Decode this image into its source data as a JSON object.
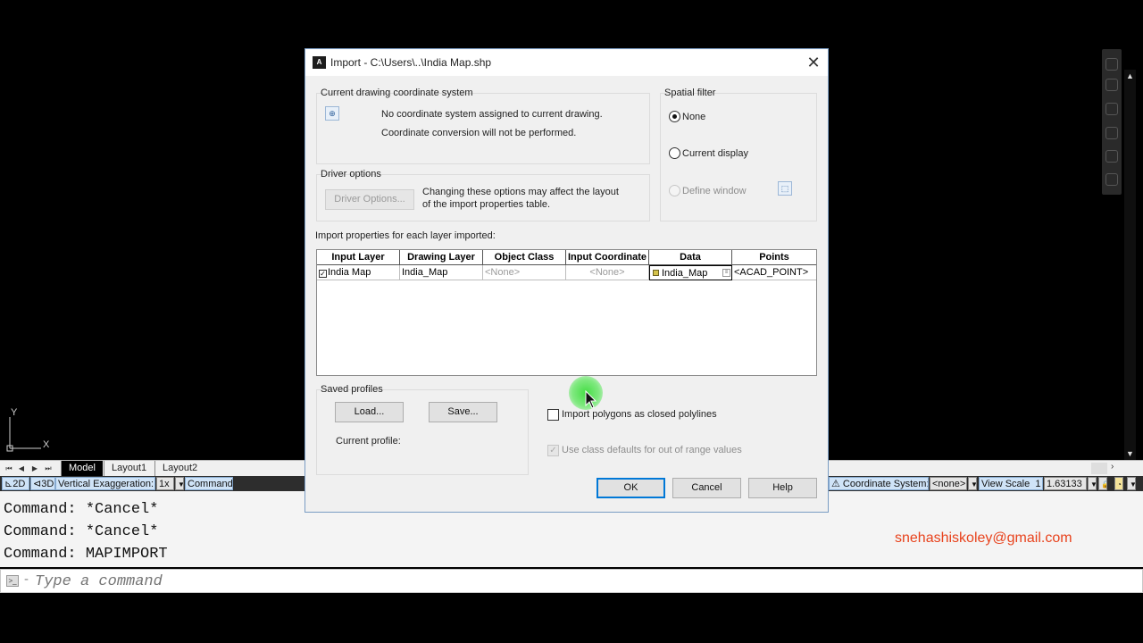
{
  "dialog": {
    "title": "Import - C:\\Users\\..\\India Map.shp",
    "coord_system": {
      "label": "Current drawing coordinate system",
      "line1": "No coordinate system assigned to current drawing.",
      "line2": "Coordinate conversion will not be performed."
    },
    "spatial_filter": {
      "label": "Spatial filter",
      "options": [
        "None",
        "Current display",
        "Define window"
      ],
      "selected": "None"
    },
    "driver_options": {
      "label": "Driver options",
      "button": "Driver Options...",
      "note_line1": "Changing these options may affect the layout",
      "note_line2": "of the import properties table."
    },
    "import_properties": {
      "label": "Import properties for each layer imported:",
      "columns": [
        "Input Layer",
        "Drawing Layer",
        "Object Class",
        "Input Coordinate",
        "Data",
        "Points"
      ],
      "rows": [
        {
          "checked": true,
          "input_layer": "India Map",
          "drawing_layer": "India_Map",
          "object_class": "<None>",
          "input_coordinate": "<None>",
          "data": "India_Map",
          "points": "<ACAD_POINT>"
        }
      ]
    },
    "saved_profiles": {
      "label": "Saved profiles",
      "load": "Load...",
      "save": "Save...",
      "current_profile_label": "Current profile:"
    },
    "options": {
      "closed_polylines": "Import polygons as closed polylines",
      "closed_polylines_checked": false,
      "class_defaults": "Use class defaults for out of range values",
      "class_defaults_checked": true
    },
    "buttons": {
      "ok": "OK",
      "cancel": "Cancel",
      "help": "Help"
    }
  },
  "cad": {
    "ucs": {
      "y": "Y",
      "x": "X"
    },
    "tabs": [
      "Model",
      "Layout1",
      "Layout2"
    ],
    "active_tab": "Model",
    "status": {
      "view_2d": "2D",
      "view_3d": "3D",
      "vertical_exaggeration_label": "Vertical Exaggeration:",
      "vertical_exaggeration_value": "1x",
      "command": "Command",
      "coordinate_system_label": "Coordinate System:",
      "coordinate_system_value": "<none>",
      "view_scale_label": "View Scale",
      "view_scale_value": "1",
      "view_scale_number": "1.63133"
    },
    "command_history": [
      "Command: *Cancel*",
      "Command: *Cancel*",
      "Command: MAPIMPORT"
    ],
    "command_placeholder": "Type a command",
    "email": "snehashiskoley@gmail.com"
  },
  "colors": {
    "email": "#e8421c",
    "cursor_highlight": "#3cdc3c",
    "dialog_border": "#7a9cc3"
  }
}
